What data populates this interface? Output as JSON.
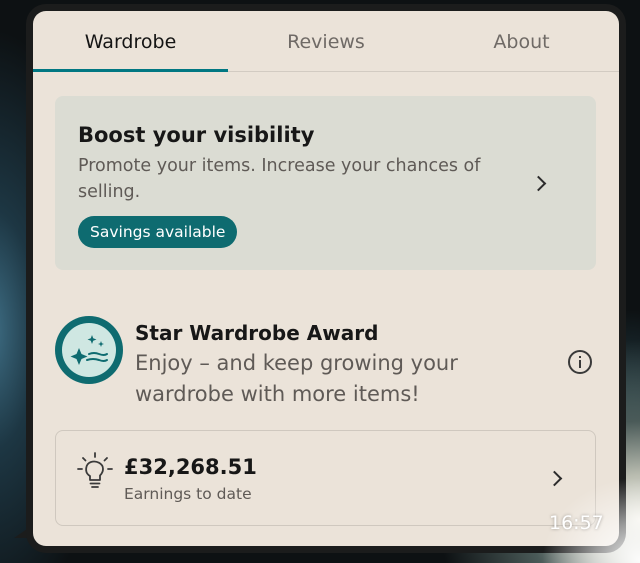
{
  "tabs": [
    {
      "label": "Wardrobe",
      "active": true
    },
    {
      "label": "Reviews",
      "active": false
    },
    {
      "label": "About",
      "active": false
    }
  ],
  "boost": {
    "title": "Boost your visibility",
    "description": "Promote your items. Increase your chances of selling.",
    "badge": "Savings available"
  },
  "award": {
    "title": "Star Wardrobe Award",
    "description": "Enjoy – and keep growing your wardrobe with more items!"
  },
  "earnings": {
    "amount": "£32,268.51",
    "label": "Earnings to date"
  },
  "status": {
    "time": "16:57"
  },
  "colors": {
    "accent": "#007782",
    "badge_bg": "#0e6b70",
    "page_bg": "#ebe3d9",
    "card_bg": "#dbdcd3"
  },
  "icons": {
    "boost_chevron": "chevron-right-icon",
    "award": "sparkle-stars-icon",
    "info": "info-icon",
    "earnings": "lightbulb-icon",
    "earnings_chevron": "chevron-right-icon"
  }
}
